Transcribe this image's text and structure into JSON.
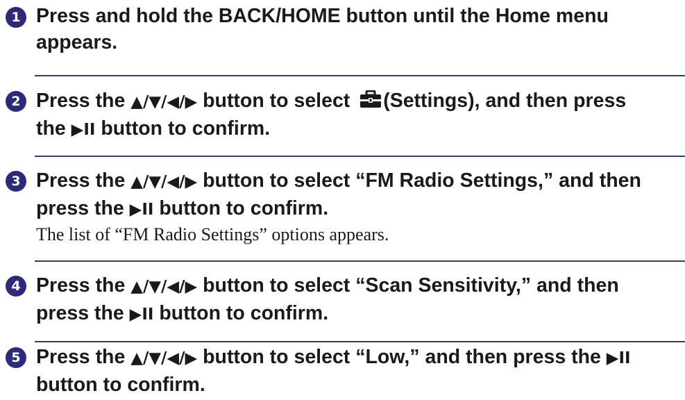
{
  "steps": [
    {
      "num": "1",
      "lines": [
        "Press and hold the BACK/HOME button until the Home menu",
        "appears."
      ]
    },
    {
      "num": "2",
      "l1_a": "Press the ",
      "arrows": "▲/▼/◀/▶",
      "l1_b": " button to select ",
      "l1_c": "(Settings), and then press",
      "l2_a": "the ",
      "play_pause": "▶II",
      "l2_b": " button to confirm."
    },
    {
      "num": "3",
      "l1_a": "Press the ",
      "arrows": "▲/▼/◀/▶",
      "l1_b": " button to select “FM Radio Settings,” and then",
      "l2_a": "press the ",
      "play_pause": "▶II",
      "l2_b": " button to confirm.",
      "note": "The list of “FM Radio Settings” options appears."
    },
    {
      "num": "4",
      "l1_a": "Press the ",
      "arrows": "▲/▼/◀/▶",
      "l1_b": " button to select “Scan Sensitivity,” and then",
      "l2_a": "press the ",
      "play_pause": "▶II",
      "l2_b": " button to confirm."
    },
    {
      "num": "5",
      "l1_a": "Press the ",
      "arrows": "▲/▼/◀/▶",
      "l1_b": " button to select “Low,” and then press the ",
      "play_pause": "▶II",
      "l2": "button to confirm."
    }
  ],
  "icons": {
    "settings": "settings-toolbox-icon"
  },
  "colors": {
    "step_badge": "#2d2a7b",
    "divider": "#3a3580",
    "text": "#1a1a1a"
  }
}
